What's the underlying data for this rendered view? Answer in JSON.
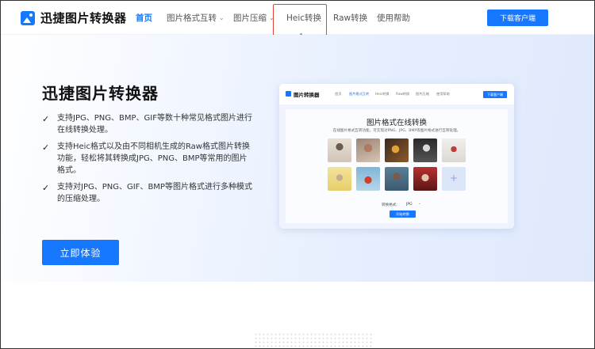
{
  "nav": {
    "logo_text": "迅捷图片转换器",
    "items": [
      {
        "label": "首页",
        "active": true
      },
      {
        "label": "图片格式互转",
        "has_dropdown": true
      },
      {
        "label": "图片压缩",
        "has_dropdown": true
      },
      {
        "label": "Heic转换",
        "highlighted": true
      },
      {
        "label": "Raw转换"
      },
      {
        "label": "使用帮助"
      }
    ],
    "download_label": "下载客户端"
  },
  "hero": {
    "title": "迅捷图片转换器",
    "features": [
      "支持JPG、PNG、BMP、GIF等数十种常见格式图片进行在线转换处理。",
      "支持Heic格式以及由不同相机生成的Raw格式图片转换功能，轻松将其转换成JPG、PNG、BMP等常用的图片格式。",
      "支持对JPG、PNG、GIF、BMP等图片格式进行多种模式的压缩处理。"
    ],
    "cta_label": "立即体验"
  },
  "mockup": {
    "logo_text": "图片转换器",
    "nav_items": [
      "首页",
      "图片格式互转",
      "Heic转换",
      "Raw转换",
      "图片压缩",
      "使用帮助"
    ],
    "download_label": "下载客户端",
    "title": "图片格式在线转换",
    "subtitle": "在线图片格式互转功能，可实现对PNG、JPG、BMP等图片格式进行互转处理。",
    "format_label": "转换格式:",
    "format_value": "JPG",
    "start_label": "开始转换",
    "add_icon": "+"
  },
  "colors": {
    "accent": "#1677ff",
    "highlight_border": "#e0423a"
  }
}
